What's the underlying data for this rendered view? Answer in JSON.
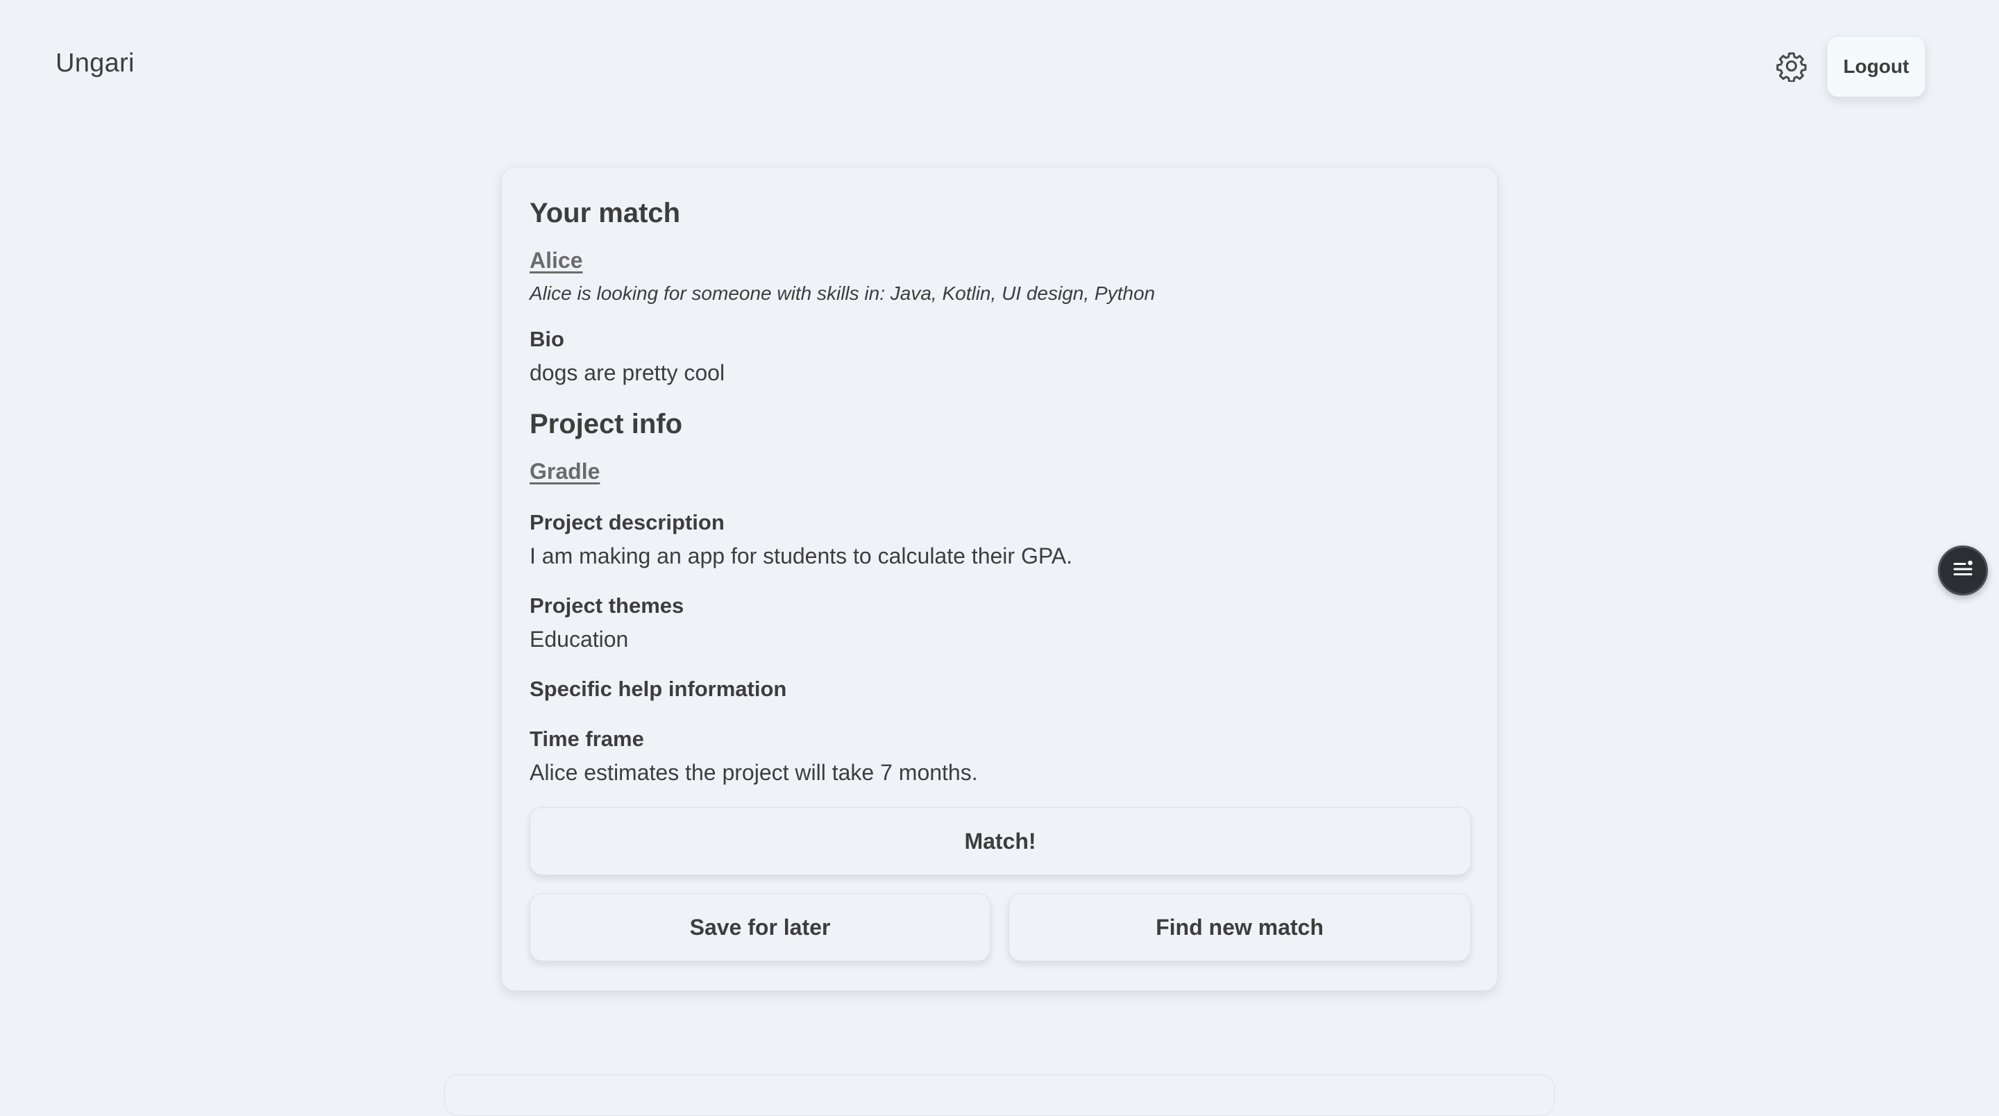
{
  "header": {
    "brand": "Ungari",
    "settings_icon": "gear-icon",
    "logout_label": "Logout"
  },
  "match": {
    "title": "Your match",
    "name": "Alice",
    "skills_text": "Alice is looking for someone with skills in: Java, Kotlin, UI design, Python",
    "bio_label": "Bio",
    "bio": "dogs are pretty cool",
    "project_title": "Project info",
    "project_name": "Gradle",
    "description_label": "Project description",
    "description": "I am making an app for students to calculate their GPA.",
    "themes_label": "Project themes",
    "themes": "Education",
    "help_label": "Specific help information",
    "timeframe_label": "Time frame",
    "timeframe": "Alice estimates the project will take 7 months."
  },
  "actions": {
    "match_label": "Match!",
    "save_label": "Save for later",
    "new_match_label": "Find new match"
  },
  "floating": {
    "icon": "menu-list-icon"
  },
  "colors": {
    "background": "#eff3f7",
    "text": "#3d3d3d",
    "link": "#6b6b6b",
    "fab": "#2b2f33"
  }
}
